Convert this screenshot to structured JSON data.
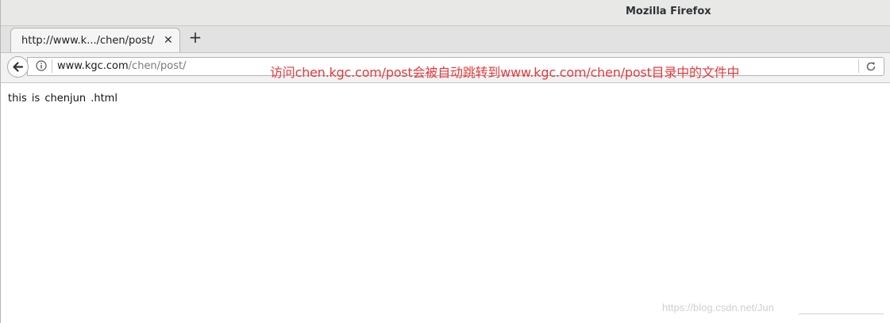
{
  "window": {
    "title": "Mozilla Firefox"
  },
  "tab": {
    "label": "http://www.k.../chen/post/",
    "close_glyph": "✕",
    "new_tab_glyph": "+"
  },
  "navbar": {
    "url_domain": "www.kgc.com",
    "url_path": "/chen/post/",
    "icons": [
      "back-arrow-icon",
      "info-icon",
      "reload-icon"
    ]
  },
  "annotation": {
    "text": "访问chen.kgc.com/post会被自动跳转到www.kgc.com/chen/post目录中的文件中",
    "color": "#e8383b"
  },
  "page": {
    "body_text": "this is chenjun .html"
  },
  "watermark": {
    "text": "https://blog.csdn.net/Jun"
  }
}
